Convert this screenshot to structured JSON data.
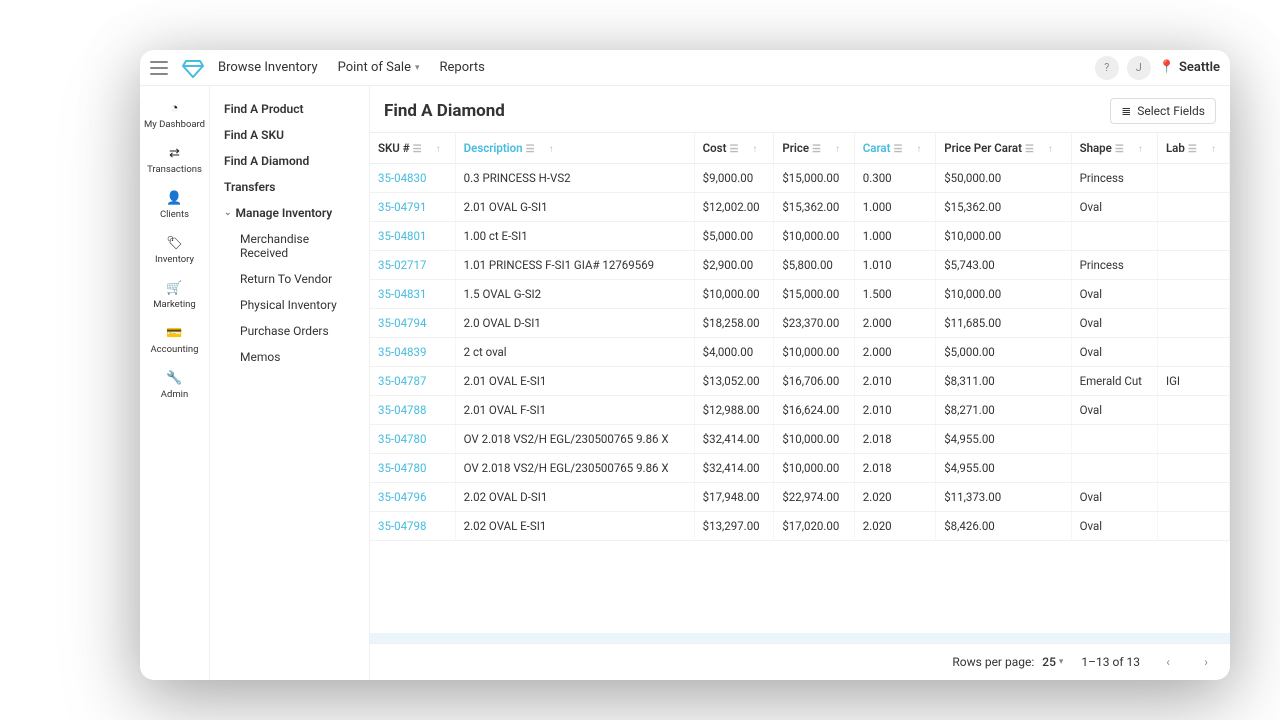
{
  "topbar": {
    "nav": {
      "browse": "Browse Inventory",
      "pos": "Point of Sale",
      "reports": "Reports"
    },
    "help": "?",
    "user_initial": "J",
    "location": "Seattle"
  },
  "sidebar": {
    "items": [
      {
        "icon": "◔",
        "label": "My Dashboard"
      },
      {
        "icon": "⇄",
        "label": "Transactions"
      },
      {
        "icon": "👤",
        "label": "Clients"
      },
      {
        "icon": "🏷",
        "label": "Inventory"
      },
      {
        "icon": "🛒",
        "label": "Marketing"
      },
      {
        "icon": "💳",
        "label": "Accounting"
      },
      {
        "icon": "🔧",
        "label": "Admin"
      }
    ]
  },
  "subnav": {
    "items": [
      {
        "label": "Find A Product",
        "bold": true
      },
      {
        "label": "Find A SKU",
        "bold": true
      },
      {
        "label": "Find A Diamond",
        "bold": true
      },
      {
        "label": "Transfers",
        "bold": true
      },
      {
        "label": "Manage Inventory",
        "group": true
      },
      {
        "label": "Merchandise Received",
        "indent": true
      },
      {
        "label": "Return To Vendor",
        "indent": true
      },
      {
        "label": "Physical Inventory",
        "indent": true
      },
      {
        "label": "Purchase Orders",
        "indent": true
      },
      {
        "label": "Memos",
        "indent": true
      }
    ]
  },
  "page": {
    "title": "Find A Diamond",
    "select_fields": "Select Fields"
  },
  "table": {
    "columns": [
      {
        "key": "sku",
        "label": "SKU #"
      },
      {
        "key": "description",
        "label": "Description",
        "highlight": true
      },
      {
        "key": "cost",
        "label": "Cost"
      },
      {
        "key": "price",
        "label": "Price"
      },
      {
        "key": "carat",
        "label": "Carat",
        "highlight": true
      },
      {
        "key": "ppc",
        "label": "Price Per Carat"
      },
      {
        "key": "shape",
        "label": "Shape"
      },
      {
        "key": "lab",
        "label": "Lab"
      }
    ],
    "rows": [
      {
        "sku": "35-04830",
        "description": "0.3 PRINCESS H-VS2",
        "cost": "$9,000.00",
        "price": "$15,000.00",
        "carat": "0.300",
        "ppc": "$50,000.00",
        "shape": "Princess",
        "lab": ""
      },
      {
        "sku": "35-04791",
        "description": "2.01 OVAL G-SI1",
        "cost": "$12,002.00",
        "price": "$15,362.00",
        "carat": "1.000",
        "ppc": "$15,362.00",
        "shape": "Oval",
        "lab": ""
      },
      {
        "sku": "35-04801",
        "description": "1.00 ct E-SI1",
        "cost": "$5,000.00",
        "price": "$10,000.00",
        "carat": "1.000",
        "ppc": "$10,000.00",
        "shape": "",
        "lab": ""
      },
      {
        "sku": "35-02717",
        "description": "1.01 PRINCESS F-SI1 GIA# 12769569",
        "cost": "$2,900.00",
        "price": "$5,800.00",
        "carat": "1.010",
        "ppc": "$5,743.00",
        "shape": "Princess",
        "lab": ""
      },
      {
        "sku": "35-04831",
        "description": "1.5 OVAL G-SI2",
        "cost": "$10,000.00",
        "price": "$15,000.00",
        "carat": "1.500",
        "ppc": "$10,000.00",
        "shape": "Oval",
        "lab": ""
      },
      {
        "sku": "35-04794",
        "description": "2.0 OVAL D-SI1",
        "cost": "$18,258.00",
        "price": "$23,370.00",
        "carat": "2.000",
        "ppc": "$11,685.00",
        "shape": "Oval",
        "lab": ""
      },
      {
        "sku": "35-04839",
        "description": "2 ct oval",
        "cost": "$4,000.00",
        "price": "$10,000.00",
        "carat": "2.000",
        "ppc": "$5,000.00",
        "shape": "Oval",
        "lab": ""
      },
      {
        "sku": "35-04787",
        "description": "2.01 OVAL E-SI1",
        "cost": "$13,052.00",
        "price": "$16,706.00",
        "carat": "2.010",
        "ppc": "$8,311.00",
        "shape": "Emerald Cut",
        "lab": "IGI"
      },
      {
        "sku": "35-04788",
        "description": "2.01 OVAL F-SI1",
        "cost": "$12,988.00",
        "price": "$16,624.00",
        "carat": "2.010",
        "ppc": "$8,271.00",
        "shape": "Oval",
        "lab": ""
      },
      {
        "sku": "35-04780",
        "description": "OV 2.018 VS2/H EGL/230500765 9.86 X",
        "cost": "$32,414.00",
        "price": "$10,000.00",
        "carat": "2.018",
        "ppc": "$4,955.00",
        "shape": "",
        "lab": ""
      },
      {
        "sku": "35-04780",
        "description": "OV 2.018 VS2/H EGL/230500765 9.86 X",
        "cost": "$32,414.00",
        "price": "$10,000.00",
        "carat": "2.018",
        "ppc": "$4,955.00",
        "shape": "",
        "lab": ""
      },
      {
        "sku": "35-04796",
        "description": "2.02 OVAL D-SI1",
        "cost": "$17,948.00",
        "price": "$22,974.00",
        "carat": "2.020",
        "ppc": "$11,373.00",
        "shape": "Oval",
        "lab": ""
      },
      {
        "sku": "35-04798",
        "description": "2.02 OVAL E-SI1",
        "cost": "$13,297.00",
        "price": "$17,020.00",
        "carat": "2.020",
        "ppc": "$8,426.00",
        "shape": "Oval",
        "lab": ""
      }
    ]
  },
  "footer": {
    "rows_per_page_label": "Rows per page:",
    "rows_per_page_value": "25",
    "range": "1–13 of 13"
  }
}
